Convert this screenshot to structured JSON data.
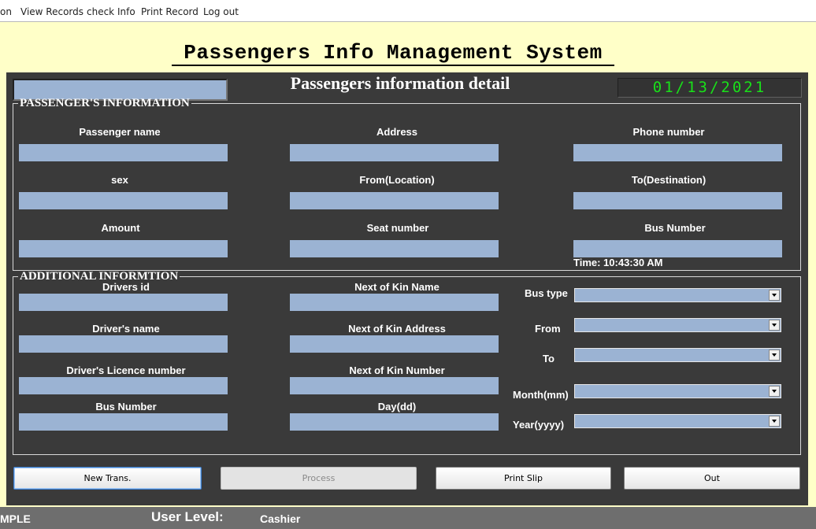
{
  "menu": [
    "on",
    "View Records",
    "check Info",
    "Print Record",
    "Log out"
  ],
  "page_title": "Passengers Info Management System",
  "panel_title": "Passengers information detail",
  "date": "01/13/2021",
  "passenger_section": {
    "legend": "PASSENGER'S INFORMATION",
    "labels": [
      "Passenger name",
      "Address",
      "Phone number",
      "sex",
      "From(Location)",
      "To(Destination)",
      "Amount",
      "Seat number",
      "Bus Number"
    ],
    "time": "Time: 10:43:30 AM"
  },
  "additional_section": {
    "legend": "ADDITIONAL INFORMTION",
    "left_labels": [
      "Drivers id",
      "Driver's name",
      "Driver's Licence number",
      "Bus Number"
    ],
    "mid_labels": [
      "Next of Kin Name",
      "Next of Kin Address",
      "Next of Kin Number",
      "Day(dd)"
    ],
    "combo_labels": [
      "Bus type",
      "From",
      "To",
      "Month(mm)",
      "Year(yyyy)"
    ]
  },
  "buttons": {
    "new_trans": "New Trans.",
    "process": "Process",
    "print_slip": "Print Slip",
    "out": "Out"
  },
  "status": {
    "left": "MPLE",
    "user_level_label": "User Level:",
    "user_level_value": "Cashier"
  }
}
